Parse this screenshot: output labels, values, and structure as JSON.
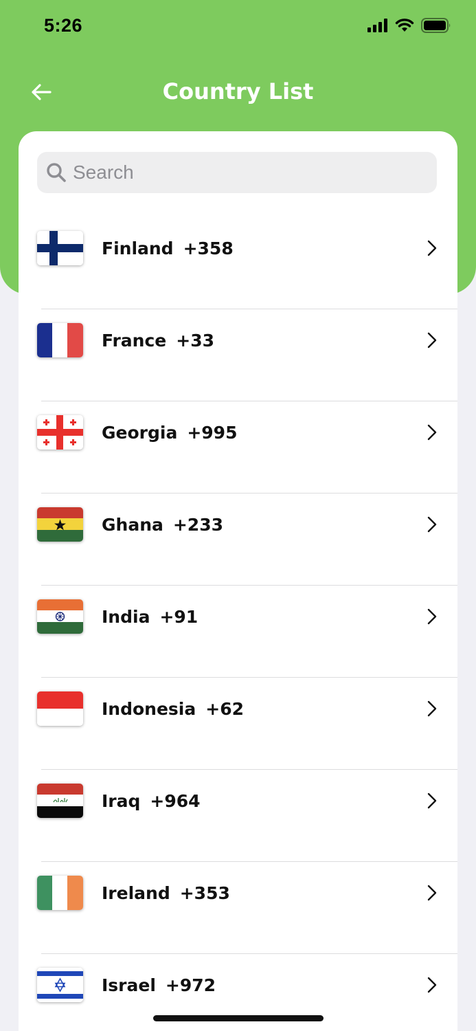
{
  "status_bar": {
    "time": "5:26"
  },
  "nav": {
    "title": "Country List"
  },
  "search": {
    "placeholder": "Search",
    "value": ""
  },
  "countries": [
    {
      "name": "Finland",
      "code": "+358",
      "flag": "finland-flag"
    },
    {
      "name": "France",
      "code": "+33",
      "flag": "france-flag"
    },
    {
      "name": "Georgia",
      "code": "+995",
      "flag": "georgia-flag"
    },
    {
      "name": "Ghana",
      "code": "+233",
      "flag": "ghana-flag"
    },
    {
      "name": "India",
      "code": "+91",
      "flag": "india-flag"
    },
    {
      "name": "Indonesia",
      "code": "+62",
      "flag": "indonesia-flag"
    },
    {
      "name": "Iraq",
      "code": "+964",
      "flag": "iraq-flag"
    },
    {
      "name": "Ireland",
      "code": "+353",
      "flag": "ireland-flag"
    },
    {
      "name": "Israel",
      "code": "+972",
      "flag": "israel-flag"
    }
  ],
  "colors": {
    "header": "#7ecb5e",
    "background": "#f0f0f5",
    "card": "#ffffff"
  }
}
